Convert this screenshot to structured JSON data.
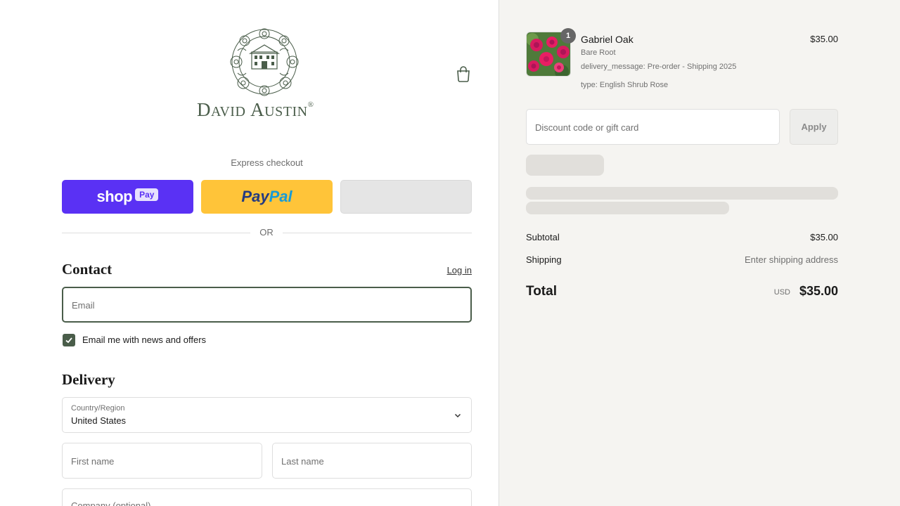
{
  "brand": {
    "logo_text_big_d": "D",
    "logo_text_avid": "AVID",
    "logo_text_big_a": "A",
    "logo_text_ustin": "USTIN",
    "logo_mark": "®",
    "accent_color": "#4a5d4a"
  },
  "express": {
    "title": "Express checkout",
    "shop_label": "shop",
    "shop_pay_label": "Pay",
    "paypal_a": "Pay",
    "paypal_b": "Pal",
    "divider": "OR"
  },
  "contact": {
    "title": "Contact",
    "login": "Log in",
    "email_placeholder": "Email",
    "newsletter_label": "Email me with news and offers",
    "newsletter_checked": true
  },
  "delivery": {
    "title": "Delivery",
    "country_label": "Country/Region",
    "country_value": "United States",
    "first_name_placeholder": "First name",
    "last_name_placeholder": "Last name",
    "company_placeholder": "Company (optional)"
  },
  "cart": {
    "quantity": "1",
    "product_name": "Gabriel Oak",
    "product_price": "$35.00",
    "variant": "Bare Root",
    "delivery_message": "delivery_message: Pre-order - Shipping 2025",
    "type": "type: English Shrub Rose"
  },
  "discount": {
    "placeholder": "Discount code or gift card",
    "apply": "Apply"
  },
  "summary": {
    "subtotal_label": "Subtotal",
    "subtotal_value": "$35.00",
    "shipping_label": "Shipping",
    "shipping_value": "Enter shipping address",
    "total_label": "Total",
    "currency": "USD",
    "total_value": "$35.00"
  }
}
